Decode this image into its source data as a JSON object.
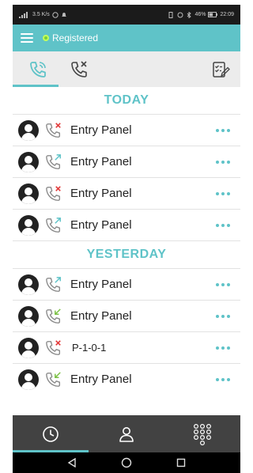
{
  "status_bar": {
    "left_text": "3.5 K/s",
    "battery": "46%",
    "time": "22:09"
  },
  "header": {
    "status_label": "Registered"
  },
  "tabs": [
    {
      "name": "all-calls",
      "icon": "phone-icon"
    },
    {
      "name": "missed-calls",
      "icon": "missed-call-icon"
    }
  ],
  "sections": {
    "today": "TODAY",
    "yesterday": "YESTERDAY"
  },
  "calls": [
    {
      "name": "Entry Panel",
      "type": "missed"
    },
    {
      "name": "Entry Panel",
      "type": "outgoing"
    },
    {
      "name": "Entry Panel",
      "type": "missed"
    },
    {
      "name": "Entry Panel",
      "type": "outgoing"
    },
    {
      "name": "Entry Panel",
      "type": "outgoing"
    },
    {
      "name": "Entry Panel",
      "type": "incoming"
    },
    {
      "name": "P-1-0-1",
      "type": "missed"
    },
    {
      "name": "Entry Panel",
      "type": "incoming"
    }
  ],
  "colors": {
    "accent": "#5fc3c8",
    "missed": "#e23b3b",
    "outgoing": "#5fc3c8",
    "incoming": "#7ac043",
    "nav_bg": "#424242"
  },
  "bottom_nav": [
    {
      "name": "recents",
      "icon": "clock-icon"
    },
    {
      "name": "contacts",
      "icon": "person-icon"
    },
    {
      "name": "dialpad",
      "icon": "dialpad-icon"
    }
  ]
}
